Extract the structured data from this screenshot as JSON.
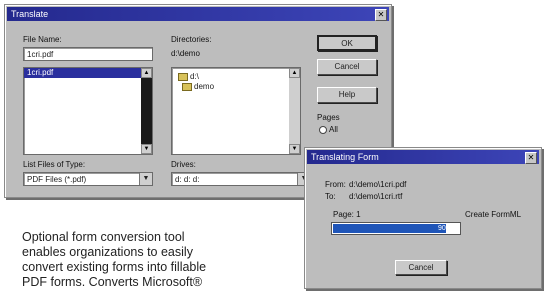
{
  "dialog": {
    "title": "Translate",
    "close": "✕",
    "file_name_label": "File Name:",
    "file_name_value": "1cri.pdf",
    "files": [
      "1cri.pdf"
    ],
    "directories_label": "Directories:",
    "directories_path": "d:\\demo",
    "tree": [
      "d:\\",
      "demo"
    ],
    "list_type_label": "List Files of Type:",
    "list_type_value": "PDF Files (*.pdf)",
    "drives_label": "Drives:",
    "drives_value": "d: d: d:",
    "ok": "OK",
    "cancel": "Cancel",
    "help": "Help",
    "pages_label": "Pages",
    "pages_all": "All"
  },
  "progress_dialog": {
    "title": "Translating Form",
    "close": "✕",
    "from_label": "From:",
    "from_value": "d:\\demo\\1cri.pdf",
    "to_label": "To:",
    "to_value": "d:\\demo\\1cri.rtf",
    "page_label": "Page: 1",
    "create_button": "Create FormML",
    "progress_percent": 0.9,
    "progress_text": "90%",
    "cancel": "Cancel"
  },
  "caption": {
    "line1": "Optional form conversion tool",
    "line2": "enables organizations to easily",
    "line3": "convert existing forms into fillable",
    "line4": "PDF forms. Converts Microsoft®"
  }
}
